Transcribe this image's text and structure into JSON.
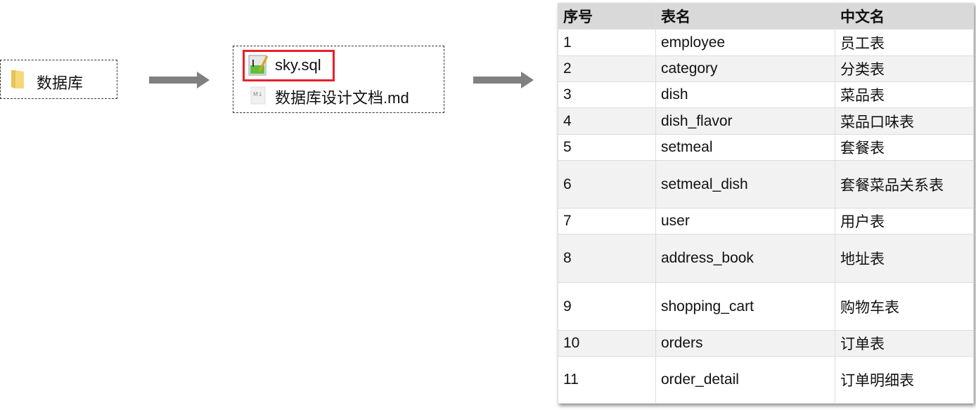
{
  "folder": {
    "name": "数据库",
    "icon": "folder-icon"
  },
  "files": [
    {
      "name": "sky.sql",
      "icon": "sql-file-icon",
      "highlighted": true,
      "highlight_color": "#e8202a"
    },
    {
      "name": "数据库设计文档.md",
      "icon": "markdown-file-icon"
    }
  ],
  "table": {
    "headers": [
      "序号",
      "表名",
      "中文名"
    ],
    "rows": [
      [
        "1",
        "employee",
        "员工表"
      ],
      [
        "2",
        "category",
        "分类表"
      ],
      [
        "3",
        "dish",
        "菜品表"
      ],
      [
        "4",
        "dish_flavor",
        "菜品口味表"
      ],
      [
        "5",
        "setmeal",
        "套餐表"
      ],
      [
        "6",
        "setmeal_dish",
        "套餐菜品关系表"
      ],
      [
        "7",
        "user",
        "用户表"
      ],
      [
        "8",
        "address_book",
        "地址表"
      ],
      [
        "9",
        "shopping_cart",
        "购物车表"
      ],
      [
        "10",
        "orders",
        "订单表"
      ],
      [
        "11",
        "order_detail",
        "订单明细表"
      ]
    ]
  }
}
